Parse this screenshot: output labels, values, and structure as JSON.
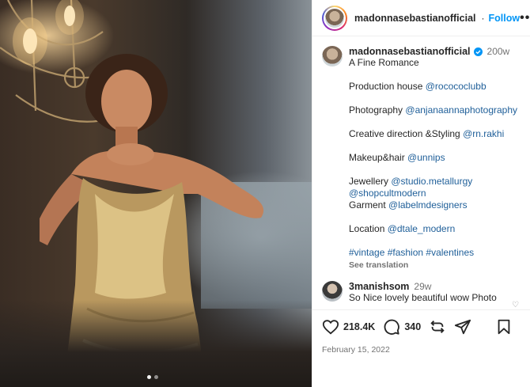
{
  "post": {
    "username": "madonnasebastianofficial",
    "follow_label": "Follow",
    "more_label": "•••",
    "caption": {
      "age": "200w",
      "lines": [
        {
          "text": "A Fine Romance"
        },
        {
          "gap": true
        },
        {
          "text": "Production house ",
          "tag": "@rocococlubb"
        },
        {
          "gap": true
        },
        {
          "text": "Photography ",
          "tag": "@anjanaannaphotography"
        },
        {
          "gap": true
        },
        {
          "text": "Creative direction &Styling ",
          "tag": "@rn.rakhi"
        },
        {
          "gap": true
        },
        {
          "text": "Makeup&hair ",
          "tag": "@unnips"
        },
        {
          "gap": true
        },
        {
          "text": "Jewellery ",
          "tag": "@studio.metallurgy"
        },
        {
          "text": "",
          "tag": "@shopcultmodern"
        },
        {
          "text": "Garment ",
          "tag": "@labelmdesigners"
        },
        {
          "gap": true
        },
        {
          "text": "Location ",
          "tag": "@dtale_modern"
        },
        {
          "gap": true
        },
        {
          "text": "",
          "tag": "#vintage #fashion #valentines"
        }
      ],
      "see_translation": "See translation"
    },
    "comment": {
      "username": "3manishsom",
      "age": "29w",
      "text": "So Nice lovely beautiful wow Photo"
    },
    "likes": "218.4K",
    "comments_count": "340",
    "date": "February 15, 2022"
  },
  "icons": {
    "verified": "verified-badge-icon",
    "like": "heart-icon",
    "comment": "comment-bubble-icon",
    "share": "share-icon",
    "repost": "repost-icon",
    "save": "bookmark-icon"
  },
  "colors": {
    "follow_blue": "#0095f6",
    "verified_blue": "#0095f6",
    "text": "#262626",
    "muted": "#737373"
  }
}
